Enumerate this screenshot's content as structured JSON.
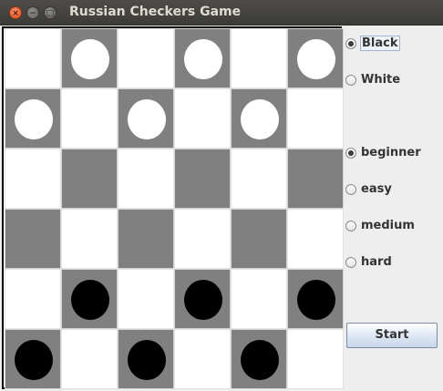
{
  "window": {
    "title": "Russian Checkers Game",
    "close_glyph": "×",
    "min_glyph": "−",
    "max_glyph": "□"
  },
  "board": {
    "rows": 6,
    "cols": 6,
    "light_color": "#ffffff",
    "dark_color": "#808080",
    "pieces": [
      {
        "row": 0,
        "col": 1,
        "color": "white"
      },
      {
        "row": 0,
        "col": 3,
        "color": "white"
      },
      {
        "row": 0,
        "col": 5,
        "color": "white"
      },
      {
        "row": 1,
        "col": 0,
        "color": "white"
      },
      {
        "row": 1,
        "col": 2,
        "color": "white"
      },
      {
        "row": 1,
        "col": 4,
        "color": "white"
      },
      {
        "row": 4,
        "col": 1,
        "color": "black"
      },
      {
        "row": 4,
        "col": 3,
        "color": "black"
      },
      {
        "row": 4,
        "col": 5,
        "color": "black"
      },
      {
        "row": 5,
        "col": 0,
        "color": "black"
      },
      {
        "row": 5,
        "col": 2,
        "color": "black"
      },
      {
        "row": 5,
        "col": 4,
        "color": "black"
      }
    ]
  },
  "side_panel": {
    "player_options": [
      {
        "label": "Black",
        "selected": true
      },
      {
        "label": "White",
        "selected": false
      }
    ],
    "difficulty_options": [
      {
        "label": "beginner",
        "selected": true
      },
      {
        "label": "easy",
        "selected": false
      },
      {
        "label": "medium",
        "selected": false
      },
      {
        "label": "hard",
        "selected": false
      }
    ],
    "start_label": "Start"
  }
}
